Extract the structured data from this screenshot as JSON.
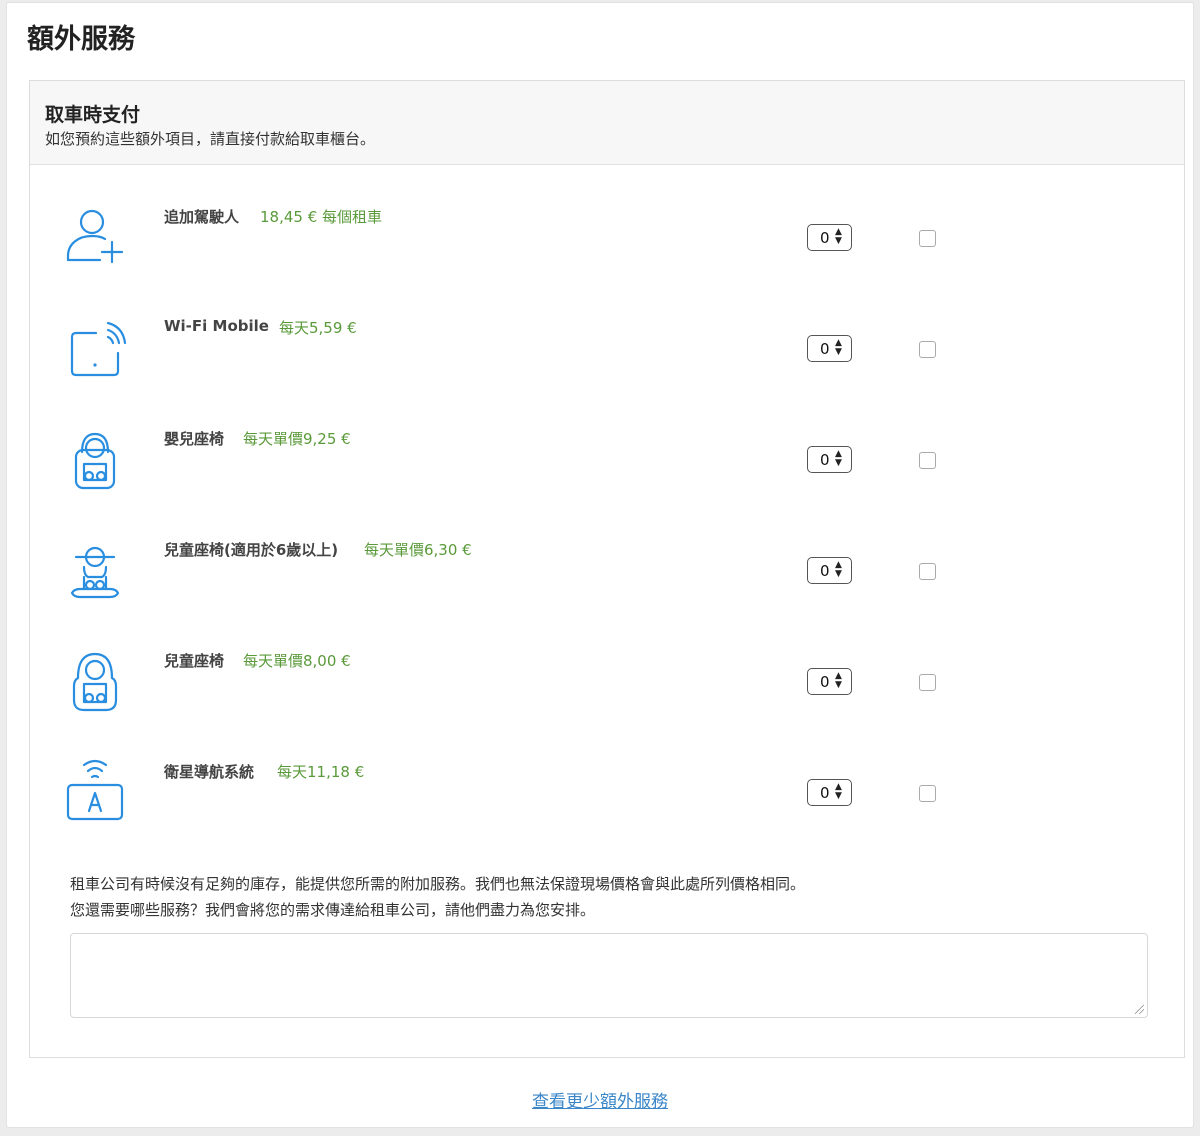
{
  "page_title": "額外服務",
  "section": {
    "title": "取車時支付",
    "subtitle": "如您預約這些額外項目，請直接付款給取車櫃台。"
  },
  "extras": [
    {
      "icon": "add-driver-icon",
      "label": "追加駕駛人",
      "price": "18,45 € 每個租車",
      "quantity": "0"
    },
    {
      "icon": "wifi-device-icon",
      "label": "Wi-Fi Mobile",
      "price": "每天5,59 €",
      "quantity": "0"
    },
    {
      "icon": "infant-seat-icon",
      "label": "嬰兒座椅",
      "price": "每天單價9,25 €",
      "quantity": "0"
    },
    {
      "icon": "booster-seat-icon",
      "label": "兒童座椅(適用於6歲以上)",
      "price": "每天單價6,30 €",
      "quantity": "0"
    },
    {
      "icon": "child-seat-icon",
      "label": "兒童座椅",
      "price": "每天單價8,00 €",
      "quantity": "0"
    },
    {
      "icon": "gps-navigation-icon",
      "label": "衛星導航系統",
      "price": "每天11,18 €",
      "quantity": "0"
    }
  ],
  "note": {
    "line1": "租車公司有時候沒有足夠的庫存，能提供您所需的附加服務。我們也無法保證現場價格會與此處所列價格相同。",
    "line2": "您還需要哪些服務？我們會將您的需求傳達給租車公司，請他們盡力為您安排。"
  },
  "request_textarea_value": "",
  "toggle_link": "查看更少額外服務",
  "colors": {
    "accent": "#2a8ee0",
    "price": "#5a9a3a",
    "link": "#3a86c8"
  }
}
